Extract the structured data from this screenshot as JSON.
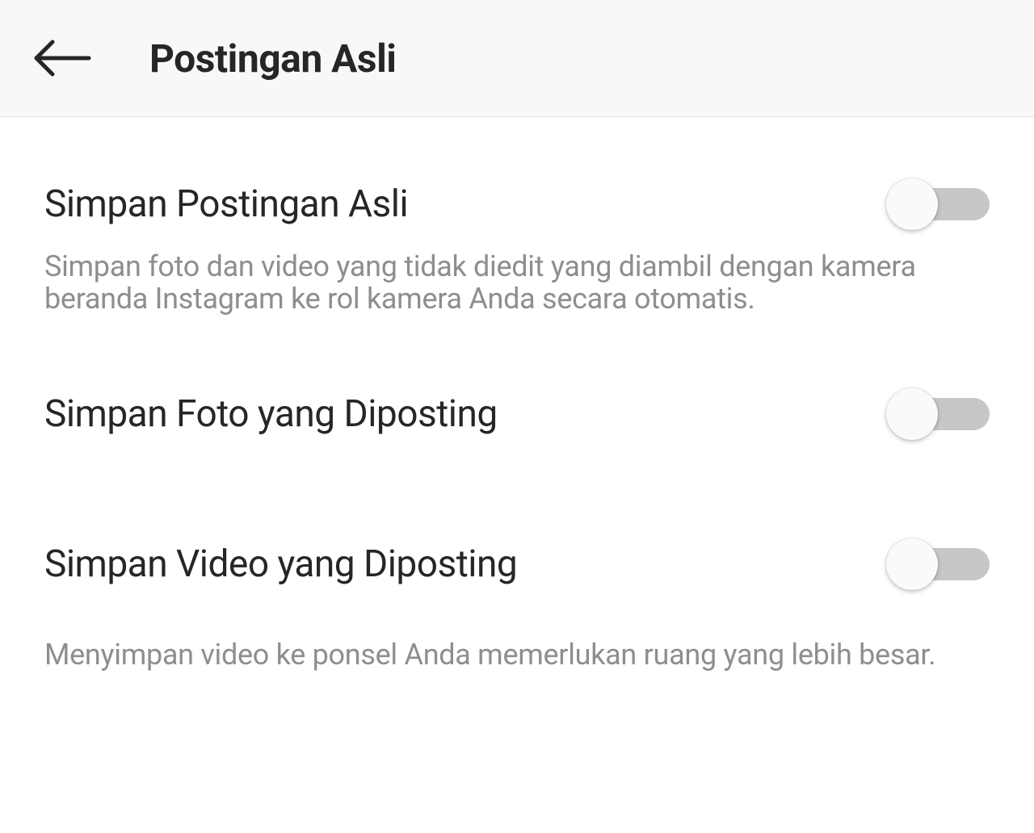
{
  "header": {
    "title": "Postingan Asli"
  },
  "settings": {
    "saveOriginal": {
      "label": "Simpan Postingan Asli",
      "description": "Simpan foto dan video yang tidak diedit yang diambil dengan kamera beranda Instagram ke rol kamera Anda secara otomatis.",
      "enabled": false
    },
    "savePostedPhoto": {
      "label": "Simpan Foto yang Diposting",
      "enabled": false
    },
    "savePostedVideo": {
      "label": "Simpan Video yang Diposting",
      "description": "Menyimpan video ke ponsel Anda memerlukan ruang yang lebih besar.",
      "enabled": false
    }
  }
}
